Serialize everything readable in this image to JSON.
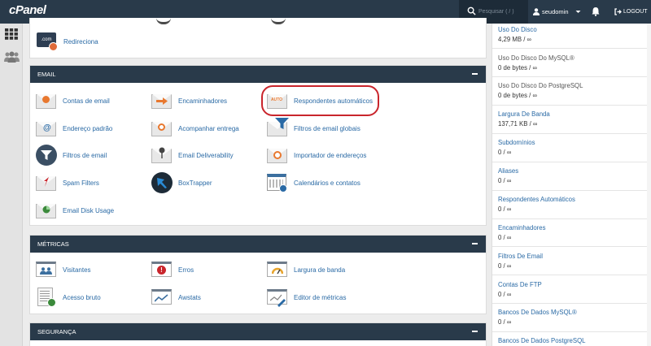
{
  "topbar": {
    "logo": "cPanel",
    "search_placeholder": "Pesquisar ( / )",
    "username": "seudomin",
    "logout": "LOGOUT"
  },
  "partial_section": {
    "tools": [
      {
        "label": "Redireciona",
        "icon": "redirect-icon"
      }
    ]
  },
  "email": {
    "title": "EMAIL",
    "tools": [
      {
        "label": "Contas de email",
        "icon": "email-accounts-icon"
      },
      {
        "label": "Encaminhadores",
        "icon": "forwarders-icon"
      },
      {
        "label": "Respondentes automáticos",
        "icon": "autoresponders-icon",
        "badge": "AUTO"
      },
      {
        "label": "Endereço padrão",
        "icon": "default-address-icon"
      },
      {
        "label": "Acompanhar entrega",
        "icon": "track-delivery-icon"
      },
      {
        "label": "Filtros de email globais",
        "icon": "global-filters-icon"
      },
      {
        "label": "Filtros de email",
        "icon": "email-filters-icon"
      },
      {
        "label": "Email Deliverability",
        "icon": "deliverability-icon"
      },
      {
        "label": "Importador de endereços",
        "icon": "address-importer-icon"
      },
      {
        "label": "Spam Filters",
        "icon": "spam-filters-icon"
      },
      {
        "label": "BoxTrapper",
        "icon": "boxtrapper-icon"
      },
      {
        "label": "Calendários e contatos",
        "icon": "calendars-icon"
      },
      {
        "label": "Email Disk Usage",
        "icon": "disk-usage-icon"
      }
    ]
  },
  "metricas": {
    "title": "MÉTRICAS",
    "tools": [
      {
        "label": "Visitantes",
        "icon": "visitors-icon"
      },
      {
        "label": "Erros",
        "icon": "errors-icon"
      },
      {
        "label": "Largura de banda",
        "icon": "bandwidth-icon"
      },
      {
        "label": "Acesso bruto",
        "icon": "raw-access-icon"
      },
      {
        "label": "Awstats",
        "icon": "awstats-icon"
      },
      {
        "label": "Editor de métricas",
        "icon": "metrics-editor-icon"
      }
    ]
  },
  "seguranca": {
    "title": "SEGURANÇA"
  },
  "stats": [
    {
      "label": "Uso Do Disco",
      "value": "4,29 MB / ∞",
      "link": true
    },
    {
      "label": "Uso Do Disco Do MySQL®",
      "value": "0 de bytes / ∞",
      "link": false
    },
    {
      "label": "Uso Do Disco Do PostgreSQL",
      "value": "0 de bytes / ∞",
      "link": false
    },
    {
      "label": "Largura De Banda",
      "value": "137,71 KB / ∞",
      "link": true
    },
    {
      "label": "Subdomínios",
      "value": "0 / ∞",
      "link": true
    },
    {
      "label": "Aliases",
      "value": "0 / ∞",
      "link": true
    },
    {
      "label": "Respondentes Automáticos",
      "value": "0 / ∞",
      "link": true
    },
    {
      "label": "Encaminhadores",
      "value": "0 / ∞",
      "link": true
    },
    {
      "label": "Filtros De Email",
      "value": "0 / ∞",
      "link": true
    },
    {
      "label": "Contas De FTP",
      "value": "0 / ∞",
      "link": true
    },
    {
      "label": "Bancos De Dados MySQL®",
      "value": "0 / ∞",
      "link": true
    },
    {
      "label": "Bancos De Dados PostgreSQL",
      "value": "",
      "link": true
    }
  ]
}
